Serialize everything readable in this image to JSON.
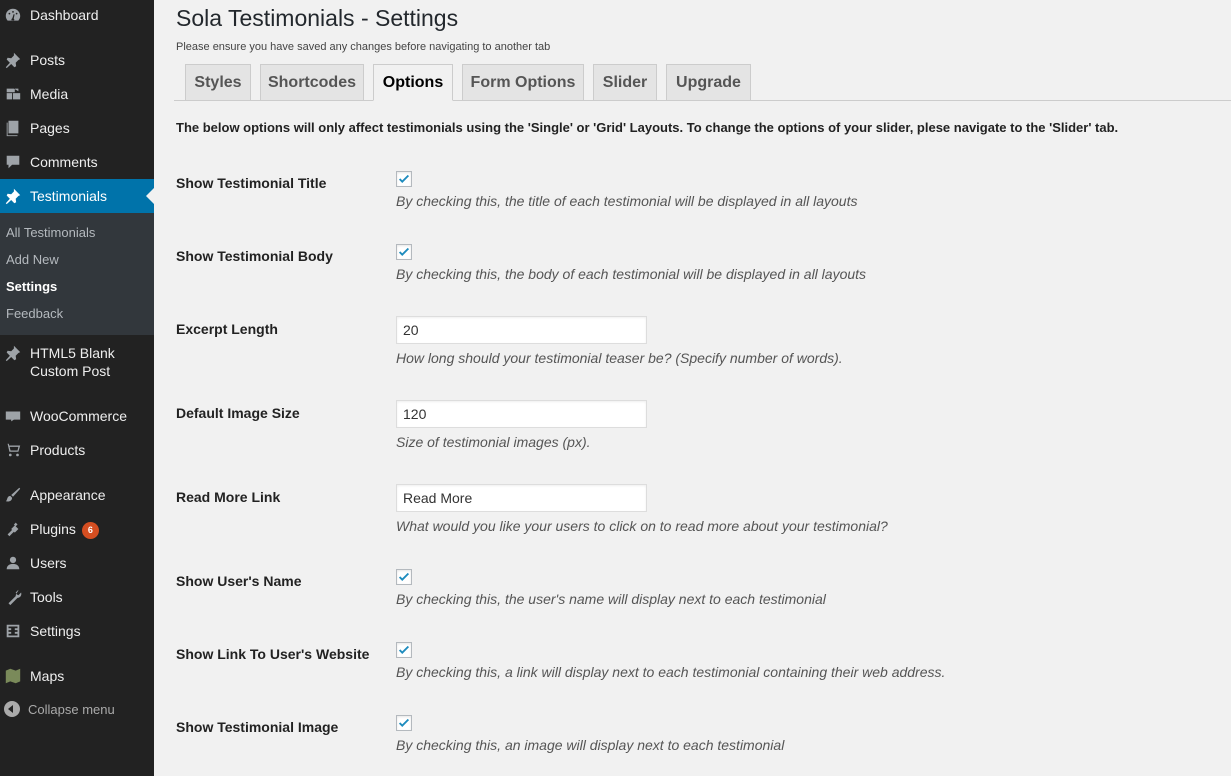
{
  "sidebar": {
    "items": [
      {
        "label": "Dashboard",
        "icon": "dashboard-icon"
      },
      {
        "label": "Posts",
        "icon": "pin-icon"
      },
      {
        "label": "Media",
        "icon": "media-icon"
      },
      {
        "label": "Pages",
        "icon": "pages-icon"
      },
      {
        "label": "Comments",
        "icon": "comment-icon"
      },
      {
        "label": "Testimonials",
        "icon": "pin-icon"
      },
      {
        "label": "HTML5 Blank Custom Post",
        "icon": "pin-icon"
      },
      {
        "label": "WooCommerce",
        "icon": "woocommerce-icon"
      },
      {
        "label": "Products",
        "icon": "cart-icon"
      },
      {
        "label": "Appearance",
        "icon": "brush-icon"
      },
      {
        "label": "Plugins",
        "icon": "plug-icon",
        "badge": "6"
      },
      {
        "label": "Users",
        "icon": "user-icon"
      },
      {
        "label": "Tools",
        "icon": "wrench-icon"
      },
      {
        "label": "Settings",
        "icon": "settings-icon"
      },
      {
        "label": "Maps",
        "icon": "map-icon"
      }
    ],
    "submenu": [
      "All Testimonials",
      "Add New",
      "Settings",
      "Feedback"
    ],
    "collapse_label": "Collapse menu"
  },
  "header": {
    "title": "Sola Testimonials - Settings",
    "notice": "Please ensure you have saved any changes before navigating to another tab"
  },
  "tabs": [
    "Styles",
    "Shortcodes",
    "Options",
    "Form Options",
    "Slider",
    "Upgrade"
  ],
  "active_tab": "Options",
  "intro": "The below options will only affect testimonials using the 'Single' or 'Grid' Layouts. To change the options of your slider, plese navigate to the 'Slider' tab.",
  "settings": [
    {
      "label": "Show Testimonial Title",
      "type": "checkbox",
      "checked": true,
      "desc": "By checking this, the title of each testimonial will be displayed in all layouts"
    },
    {
      "label": "Show Testimonial Body",
      "type": "checkbox",
      "checked": true,
      "desc": "By checking this, the body of each testimonial will be displayed in all layouts"
    },
    {
      "label": "Excerpt Length",
      "type": "text",
      "value": "20",
      "desc": "How long should your testimonial teaser be? (Specify number of words)."
    },
    {
      "label": "Default Image Size",
      "type": "text",
      "value": "120",
      "desc": "Size of testimonial images (px)."
    },
    {
      "label": "Read More Link",
      "type": "text",
      "value": "Read More",
      "desc": "What would you like your users to click on to read more about your testimonial?"
    },
    {
      "label": "Show User's Name",
      "type": "checkbox",
      "checked": true,
      "desc": "By checking this, the user's name will display next to each testimonial"
    },
    {
      "label": "Show Link To User's Website",
      "type": "checkbox",
      "checked": true,
      "desc": "By checking this, a link will display next to each testimonial containing their web address."
    },
    {
      "label": "Show Testimonial Image",
      "type": "checkbox",
      "checked": true,
      "desc": "By checking this, an image will display next to each testimonial"
    }
  ],
  "colors": {
    "sidebar_bg": "#222222",
    "submenu_bg": "#32373c",
    "accent": "#0073aa",
    "check": "#1e8cbe",
    "badge": "#d54e21"
  }
}
